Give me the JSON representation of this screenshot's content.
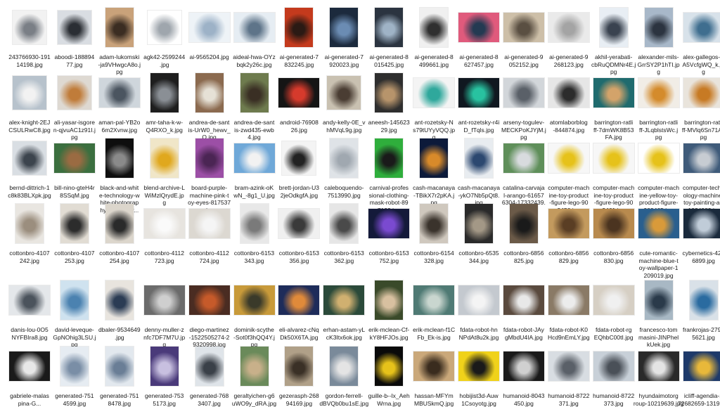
{
  "files": [
    {
      "name": "243766930-191\n14198.jpg",
      "thumb": [
        "#f2f2f2",
        "#7a7f86"
      ],
      "shape": "sq"
    },
    {
      "name": "aboodi-188894\n77.jpg",
      "thumb": [
        "#d9dde2",
        "#2a2e34"
      ],
      "shape": "sq"
    },
    {
      "name": "adam-lukomski\n-ja9VHwgcA8o.j\npg",
      "thumb": [
        "#c9a27a",
        "#3b2d22"
      ],
      "shape": "pt"
    },
    {
      "name": "agk42-2599244\n.jpg",
      "thumb": [
        "#ffffff",
        "#9fa6ad"
      ],
      "shape": "sq"
    },
    {
      "name": "ai-9565204.jpg",
      "thumb": [
        "#eef3f7",
        "#9db2c7"
      ],
      "shape": "ls"
    },
    {
      "name": "aideal-hwa-OYz\nbqk2y26c.jpg",
      "thumb": [
        "#e6edf3",
        "#5e7489"
      ],
      "shape": "ls"
    },
    {
      "name": "ai-generated-7\n832245.jpg",
      "thumb": [
        "#c43a1d",
        "#2b1a14"
      ],
      "shape": "pt"
    },
    {
      "name": "ai-generated-7\n920023.jpg",
      "thumb": [
        "#1c2a3d",
        "#6b8cb3"
      ],
      "shape": "pt"
    },
    {
      "name": "ai-generated-8\n015425.jpg",
      "thumb": [
        "#2b3440",
        "#9fb3c6"
      ],
      "shape": "pt"
    },
    {
      "name": "ai-generated-8\n499661.jpg",
      "thumb": [
        "#f0f0f0",
        "#303030"
      ],
      "shape": "pt"
    },
    {
      "name": "ai-generated-8\n627457.jpg",
      "thumb": [
        "#e05a7c",
        "#243a52"
      ],
      "shape": "ls"
    },
    {
      "name": "ai-generated-9\n052152.jpg",
      "thumb": [
        "#cdbfa8",
        "#5a4f42"
      ],
      "shape": "ls"
    },
    {
      "name": "ai-generated-9\n268123.jpg",
      "thumb": [
        "#eaeaea",
        "#a4a4a4"
      ],
      "shape": "ls"
    },
    {
      "name": "akhil-yerabati-\ncbRuQDMNr4E.j\npg",
      "thumb": [
        "#e8eef4",
        "#3a4350"
      ],
      "shape": "pt"
    },
    {
      "name": "alexander-mils-\nGrrSY2P1hTI.jp\ng",
      "thumb": [
        "#a8b8c9",
        "#2c3440"
      ],
      "shape": "pt"
    },
    {
      "name": "alex-gallegos-S\nA5VcfgWQ_k.jp\ng",
      "thumb": [
        "#d8e2ea",
        "#3f6e8f"
      ],
      "shape": "ls"
    },
    {
      "name": "alex-knight-2EJ\nCSULRwC8.jpg",
      "thumb": [
        "#b7c2cc",
        "#f2f2f2"
      ],
      "shape": "sq"
    },
    {
      "name": "ali-yasar-isgore\nn-qjvuAC1z91I.j\npg",
      "thumb": [
        "#ded9d2",
        "#c07c3a"
      ],
      "shape": "sq"
    },
    {
      "name": "aman-pal-YB2o\n6m2Xvnw.jpg",
      "thumb": [
        "#cfd6dc",
        "#4b5560"
      ],
      "shape": "ls"
    },
    {
      "name": "amr-taha-k-w-\nQ4RXO_k.jpg",
      "thumb": [
        "#1e1e1e",
        "#8a8f95"
      ],
      "shape": "pt"
    },
    {
      "name": "andrea-de-sant\nis-UrW0_hewv_\nQ.jpg",
      "thumb": [
        "#8b6a4f",
        "#e6e1d6"
      ],
      "shape": "pt"
    },
    {
      "name": "andrea-de-sant\nis-zwd435-ewb\n4.jpg",
      "thumb": [
        "#6e7b4e",
        "#3a2f24"
      ],
      "shape": "pt"
    },
    {
      "name": "android-76908\n26.jpg",
      "thumb": [
        "#151515",
        "#d63a2c"
      ],
      "shape": "ls"
    },
    {
      "name": "andy-kelly-0E_v\nhMVqL9g.jpg",
      "thumb": [
        "#c9c1b1",
        "#4a3d33"
      ],
      "shape": "sq"
    },
    {
      "name": "aneesh-145623\n29.jpg",
      "thumb": [
        "#2e2e2e",
        "#b7946b"
      ],
      "shape": "pt"
    },
    {
      "name": "ant-rozetsky-N\ns79tUYyVQQ.jp\ng",
      "thumb": [
        "#f4f4f4",
        "#2fa89c"
      ],
      "shape": "ls"
    },
    {
      "name": "ant-rozetsky-r4i\nD_fTqls.jpg",
      "thumb": [
        "#101820",
        "#28c2a0"
      ],
      "shape": "ls"
    },
    {
      "name": "arseny-togulev-\nMECKPoKJYjM.j\npg",
      "thumb": [
        "#d2d6da",
        "#5a6068"
      ],
      "shape": "ls"
    },
    {
      "name": "atomlaborblog\n-844874.jpg",
      "thumb": [
        "#e6e6e6",
        "#2c2c2c"
      ],
      "shape": "ls"
    },
    {
      "name": "barrington-ratli\nff-7dmWK8B53\nFA.jpg",
      "thumb": [
        "#1f6b6e",
        "#d3a36a"
      ],
      "shape": "ls"
    },
    {
      "name": "barrington-ratli\nff-JLqblstsWc.j\npg",
      "thumb": [
        "#f1ede6",
        "#d48b2c"
      ],
      "shape": "ls"
    },
    {
      "name": "barrington-ratli\nff-MVlq6Sn71A.j\npg",
      "thumb": [
        "#e9e4dc",
        "#c77a24"
      ],
      "shape": "ls"
    },
    {
      "name": "bernd-dittrich-1\nc8k83BLXpk.jpg",
      "thumb": [
        "#d9dee3",
        "#3c444d"
      ],
      "shape": "sq"
    },
    {
      "name": "bill-nino-gteH4r\n8SSqM.jpg",
      "thumb": [
        "#3b6f3f",
        "#9a6b42"
      ],
      "shape": "ls"
    },
    {
      "name": "black-and-whit\ne-technology-w\nhite-photograp\nhy-photo-eur...",
      "thumb": [
        "#0e0e0e",
        "#8a8a8a"
      ],
      "shape": "pt"
    },
    {
      "name": "blend-archive-L\nWiMzlQrydE.jp\ng",
      "thumb": [
        "#f0e6c8",
        "#e0a81e"
      ],
      "shape": "pt"
    },
    {
      "name": "board-purple-\nmachine-pink-t\noy-eyes-817537\n.jpg",
      "thumb": [
        "#9c4fa6",
        "#4b2554"
      ],
      "shape": "pt"
    },
    {
      "name": "bram-azink-oK\nwN_-8g1_U.jpg",
      "thumb": [
        "#6fa8d8",
        "#f2f2f2"
      ],
      "shape": "ls"
    },
    {
      "name": "brett-jordan-U3\n2jeOdkgfA.jpg",
      "thumb": [
        "#f4f4f4",
        "#222222"
      ],
      "shape": "sq"
    },
    {
      "name": "caleboquendo-\n7513990.jpg",
      "thumb": [
        "#dfe3e7",
        "#a0a8b0"
      ],
      "shape": "pt"
    },
    {
      "name": "carnival-profes\nsional-clothing-\nmask-robot-89\n7192.jpg",
      "thumb": [
        "#2fae3c",
        "#1a1a1a"
      ],
      "shape": "pt"
    },
    {
      "name": "cash-macanaya\n-TBikX7r2pKA.j\npg",
      "thumb": [
        "#0c1a3a",
        "#d88a2a"
      ],
      "shape": "pt"
    },
    {
      "name": "cash-macanaya\n-ykO7Nb5pQt8.\njpg",
      "thumb": [
        "#e8ecf0",
        "#2c4870"
      ],
      "shape": "pt"
    },
    {
      "name": "catalina-carvaja\nl-arango-61657\n6304-17332439.\njpg",
      "thumb": [
        "#5f8f5a",
        "#d8dbde"
      ],
      "shape": "ls"
    },
    {
      "name": "computer-mach\nine-toy-product\n-figure-lego-90\n9456.jpg",
      "thumb": [
        "#f7f7f7",
        "#e6c21a"
      ],
      "shape": "ls"
    },
    {
      "name": "computer-mach\nine-toy-product\n-figure-lego-90\n9461.jpg",
      "thumb": [
        "#f7f7f7",
        "#e6c21a"
      ],
      "shape": "ls"
    },
    {
      "name": "computer-mach\nine-yellow-toy-\nproduct-figure-\n909465.jpg",
      "thumb": [
        "#ffffff",
        "#e6c21a"
      ],
      "shape": "ls"
    },
    {
      "name": "computer-techn\nology-machine-\ntoy-painting-art\n-1334989.jpg",
      "thumb": [
        "#3f5b7a",
        "#c7ccd2"
      ],
      "shape": "ls"
    },
    {
      "name": "cottonbro-4107\n242.jpg",
      "thumb": [
        "#e9e6e1",
        "#9b8e7e"
      ],
      "shape": "pt"
    },
    {
      "name": "cottonbro-4107\n253.jpg",
      "thumb": [
        "#e1dcd3",
        "#2c2c2c"
      ],
      "shape": "pt"
    },
    {
      "name": "cottonbro-4107\n254.jpg",
      "thumb": [
        "#dcd6cc",
        "#2a2a2a"
      ],
      "shape": "pt"
    },
    {
      "name": "cottonbro-4112\n723.jpg",
      "thumb": [
        "#e7e4df",
        "#fafafa"
      ],
      "shape": "ls"
    },
    {
      "name": "cottonbro-4112\n724.jpg",
      "thumb": [
        "#dcd8d1",
        "#f5f5f5"
      ],
      "shape": "ls"
    },
    {
      "name": "cottonbro-6153\n343.jpg",
      "thumb": [
        "#e8e8e8",
        "#7a7a7a"
      ],
      "shape": "pt"
    },
    {
      "name": "cottonbro-6153\n356.jpg",
      "thumb": [
        "#f0f0f0",
        "#3a3a3a"
      ],
      "shape": "ls"
    },
    {
      "name": "cottonbro-6153\n362.jpg",
      "thumb": [
        "#e6e6e6",
        "#4a4a4a"
      ],
      "shape": "pt"
    },
    {
      "name": "cottonbro-6153\n752.jpg",
      "thumb": [
        "#141a3a",
        "#7a4ad0"
      ],
      "shape": "ls"
    },
    {
      "name": "cottonbro-6154\n328.jpg",
      "thumb": [
        "#cfc8be",
        "#3a332c"
      ],
      "shape": "pt"
    },
    {
      "name": "cottonbro-6535\n344.jpg",
      "thumb": [
        "#2a2a2a",
        "#a39886"
      ],
      "shape": "pt"
    },
    {
      "name": "cottonbro-6856\n825.jpg",
      "thumb": [
        "#6b5a48",
        "#1a1a1a"
      ],
      "shape": "pt"
    },
    {
      "name": "cottonbro-6856\n829.jpg",
      "thumb": [
        "#c39a5e",
        "#5a3e24"
      ],
      "shape": "ls"
    },
    {
      "name": "cottonbro-6856\n830.jpg",
      "thumb": [
        "#b88a4e",
        "#4b3420"
      ],
      "shape": "ls"
    },
    {
      "name": "cute-romantic-\nmachine-blue-t\noy-wallpaper-1\n209019.jpg",
      "thumb": [
        "#2a5f8e",
        "#d99a3a"
      ],
      "shape": "ls"
    },
    {
      "name": "cybernetics-421\n6899.jpg",
      "thumb": [
        "#1a2a3c",
        "#c0ccd8"
      ],
      "shape": "ls"
    },
    {
      "name": "danis-lou-0O5\nNYFBIra8.jpg",
      "thumb": [
        "#e4e7ea",
        "#4b535c"
      ],
      "shape": "ls"
    },
    {
      "name": "david-leveque-\nGpNOhig3LSU.j\npg",
      "thumb": [
        "#cfe2ef",
        "#4b82b0"
      ],
      "shape": "pt"
    },
    {
      "name": "dbaler-9534649\n.jpg",
      "thumb": [
        "#e8e4de",
        "#2b3c54"
      ],
      "shape": "pt"
    },
    {
      "name": "denny-muller-z\nnfc7DF7M7U.jp\ng",
      "thumb": [
        "#6b6b6b",
        "#cfcfcf"
      ],
      "shape": "ls"
    },
    {
      "name": "diego-martinez\n-1522505274-2\n9320998.jpg",
      "thumb": [
        "#4a2c22",
        "#c65a2a"
      ],
      "shape": "ls"
    },
    {
      "name": "dominik-scythe\n-Sot0f3hQQ4Y.j\npg",
      "thumb": [
        "#c89a3a",
        "#3a3a2a"
      ],
      "shape": "ls"
    },
    {
      "name": "eli-alvarez-cNq\nDk50X6TA.jpg",
      "thumb": [
        "#1e2c5a",
        "#e08a3a"
      ],
      "shape": "ls"
    },
    {
      "name": "erhan-astam-yL\ncK3Itx6ok.jpg",
      "thumb": [
        "#2b4a3a",
        "#d0b070"
      ],
      "shape": "ls"
    },
    {
      "name": "erik-mclean-Cf-\nkY8HFJOs.jpg",
      "thumb": [
        "#3a4a2a",
        "#d8c0a0"
      ],
      "shape": "pt"
    },
    {
      "name": "erik-mclean-f1C\nFb_Ek-is.jpg",
      "thumb": [
        "#4f7a74",
        "#c9d6cf"
      ],
      "shape": "ls"
    },
    {
      "name": "fdata-robot-hn\nNPdAt8u2k.jpg",
      "thumb": [
        "#c4c9cf",
        "#f4f4f4"
      ],
      "shape": "ls"
    },
    {
      "name": "fdata-robot-JAy\ngMbdU4IA.jpg",
      "thumb": [
        "#5a4a3e",
        "#e8e8e8"
      ],
      "shape": "ls"
    },
    {
      "name": "fdata-robot-K0\nHcd9nEmLY.jpg",
      "thumb": [
        "#8a7a66",
        "#ececec"
      ],
      "shape": "ls"
    },
    {
      "name": "fdata-robot-rg\nEQhbC00tI.jpg",
      "thumb": [
        "#d6cfc4",
        "#f0f0f0"
      ],
      "shape": "ls"
    },
    {
      "name": "francesco-tom\nmasini-JINPhel\nkUek.jpg",
      "thumb": [
        "#a8b8c4",
        "#2a3a4a"
      ],
      "shape": "pt"
    },
    {
      "name": "frankrojas-2791\n5621.jpg",
      "thumb": [
        "#d9e1e8",
        "#2a6ba0"
      ],
      "shape": "pt"
    },
    {
      "name": "gabriele-malas\npina-G...",
      "thumb": [
        "#1a1a1a",
        "#e8e8e8"
      ],
      "shape": "ls"
    },
    {
      "name": "generated-751\n4599.jpg",
      "thumb": [
        "#e6ecf2",
        "#7a8ea6"
      ],
      "shape": "pt"
    },
    {
      "name": "generated-751\n8478.jpg",
      "thumb": [
        "#e2e8ee",
        "#6a7e96"
      ],
      "shape": "pt"
    },
    {
      "name": "generated-753\n5173.jpg",
      "thumb": [
        "#4a3a7a",
        "#c8c0e0"
      ],
      "shape": "pt"
    },
    {
      "name": "generated-768\n3407.jpg",
      "thumb": [
        "#dfe4e9",
        "#3a4048"
      ],
      "shape": "pt"
    },
    {
      "name": "geraltyichen-g6\nuWO9y_dRA.jpg",
      "thumb": [
        "#6a8a5a",
        "#c8b08a"
      ],
      "shape": "pt"
    },
    {
      "name": "gezerasph-268\n94169.jpg",
      "thumb": [
        "#b0a088",
        "#3a3026"
      ],
      "shape": "pt"
    },
    {
      "name": "gordon-ferrell-\ndBVQb0bu1sE.jpg",
      "thumb": [
        "#7a8a9a",
        "#e4e4e4"
      ],
      "shape": "pt"
    },
    {
      "name": "guille-b--lx_Aeh\nWrna.jpg",
      "thumb": [
        "#0a0a0a",
        "#e6c21a"
      ],
      "shape": "pt"
    },
    {
      "name": "hassan-MFYm\nMBUSkmQ.jpg",
      "thumb": [
        "#caa87a",
        "#3a2c1e"
      ],
      "shape": "ls"
    },
    {
      "name": "hobijist3d-Auw\n1Csoyotg.jpg",
      "thumb": [
        "#f0d21a",
        "#1a1a1a"
      ],
      "shape": "ls"
    },
    {
      "name": "humanoid-8043\n450.jpg",
      "thumb": [
        "#1a1a1a",
        "#d0d0d0"
      ],
      "shape": "ls"
    },
    {
      "name": "humanoid-8722\n371.jpg",
      "thumb": [
        "#d8dde2",
        "#5a6068"
      ],
      "shape": "ls"
    },
    {
      "name": "humanoid-8722\n373.jpg",
      "thumb": [
        "#c8d0d8",
        "#4a5058"
      ],
      "shape": "ls"
    },
    {
      "name": "hyundaimotorg\nroup-10219639.jpg",
      "thumb": [
        "#2a2a2a",
        "#e4e4e4"
      ],
      "shape": "ls"
    },
    {
      "name": "icliff-agendia-2\n72682659-1319.jpg",
      "thumb": [
        "#1e3a6a",
        "#e8b83a"
      ],
      "shape": "ls"
    }
  ]
}
